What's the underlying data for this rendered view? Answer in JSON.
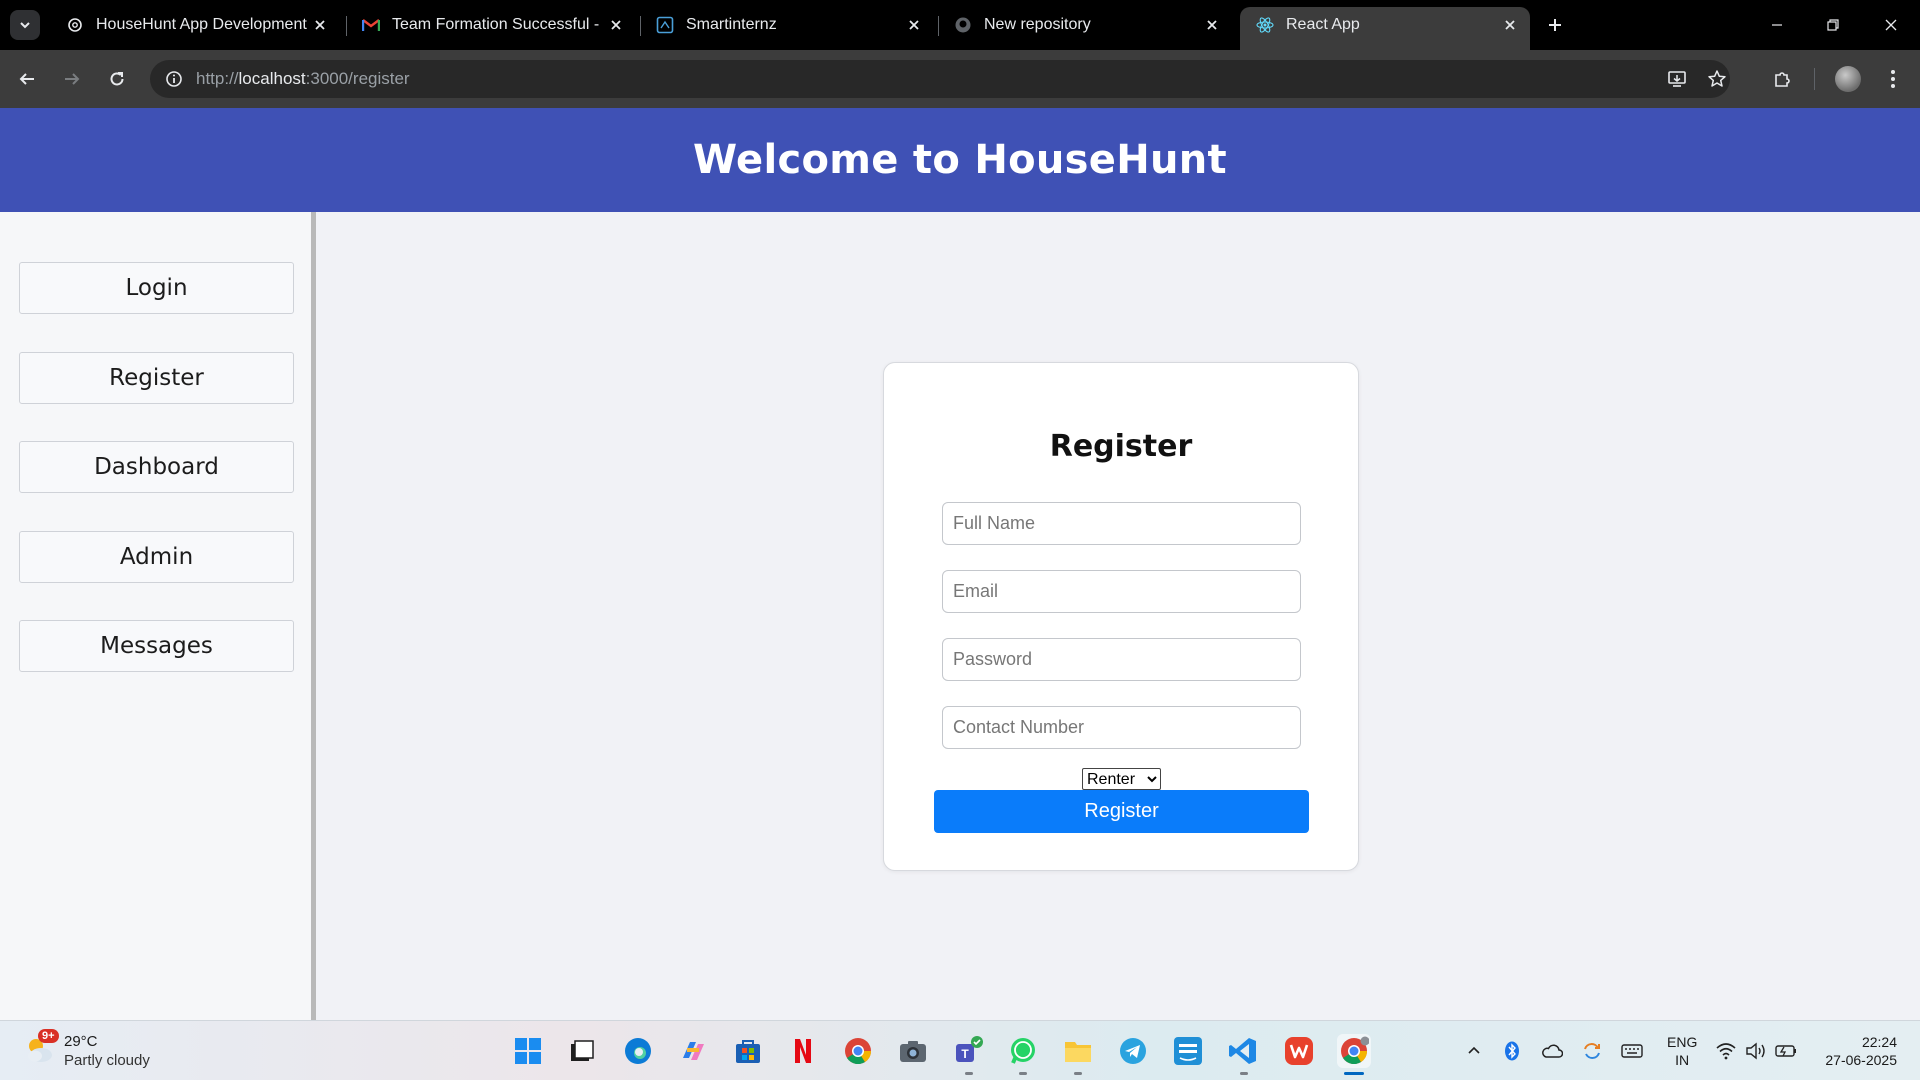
{
  "browser": {
    "tabs": [
      {
        "title": "HouseHunt App Development",
        "active": false
      },
      {
        "title": "Team Formation Successful - Sm",
        "active": false
      },
      {
        "title": "Smartinternz",
        "active": false
      },
      {
        "title": "New repository",
        "active": false
      },
      {
        "title": "React App",
        "active": true
      }
    ],
    "url": {
      "scheme": "http://",
      "host": "localhost",
      "rest": ":3000/register"
    }
  },
  "header": {
    "title": "Welcome to HouseHunt"
  },
  "sidebar": {
    "items": [
      {
        "label": "Login"
      },
      {
        "label": "Register"
      },
      {
        "label": "Dashboard"
      },
      {
        "label": "Admin"
      },
      {
        "label": "Messages"
      }
    ]
  },
  "form": {
    "title": "Register",
    "fields": {
      "full_name": {
        "placeholder": "Full Name",
        "value": ""
      },
      "email": {
        "placeholder": "Email",
        "value": ""
      },
      "password": {
        "placeholder": "Password",
        "value": ""
      },
      "contact": {
        "placeholder": "Contact Number",
        "value": ""
      }
    },
    "role": {
      "selected": "Renter"
    },
    "submit_label": "Register"
  },
  "taskbar": {
    "weather": {
      "temp": "29°C",
      "desc": "Partly cloudy",
      "badge": "9+"
    },
    "language": {
      "line1": "ENG",
      "line2": "IN"
    },
    "clock": {
      "time": "22:24",
      "date": "27-06-2025"
    }
  },
  "colors": {
    "header_bg": "#3f51b5",
    "submit_bg": "#0a7cfa",
    "page_bg": "#f1f2f6",
    "sidebar_bg": "#f6f7f9"
  }
}
